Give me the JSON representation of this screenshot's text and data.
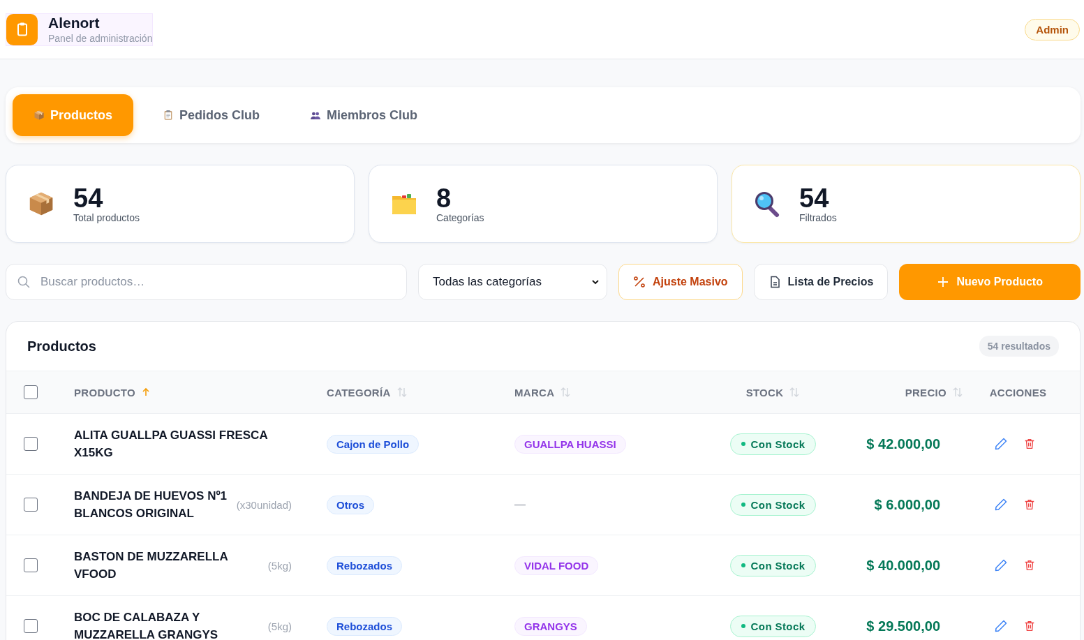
{
  "header": {
    "app_name": "Alenort",
    "subtitle": "Panel de administración",
    "role_badge": "Admin"
  },
  "tabs": [
    {
      "label": "Productos",
      "selected": true
    },
    {
      "label": "Pedidos Club",
      "selected": false
    },
    {
      "label": "Miembros Club",
      "selected": false
    }
  ],
  "stats": [
    {
      "value": "54",
      "label": "Total productos",
      "highlighted": false
    },
    {
      "value": "8",
      "label": "Categorías",
      "highlighted": false
    },
    {
      "value": "54",
      "label": "Filtrados",
      "highlighted": true
    }
  ],
  "toolbar": {
    "search": {
      "placeholder": "Buscar productos…"
    },
    "category_select": {
      "value": "Todas las categorías"
    },
    "buttons": [
      {
        "label": "Ajuste Masivo",
        "kind": "warning"
      },
      {
        "label": "Lista de Precios",
        "kind": "outline"
      },
      {
        "label": "Nuevo Producto",
        "kind": "primary"
      }
    ]
  },
  "table": {
    "title": "Productos",
    "count": "54 resultados",
    "select_all": {
      "checked": false
    },
    "columns": [
      {
        "label": "PRODUCTO",
        "kind": "sorted"
      },
      {
        "label": "CATEGORÍA",
        "kind": "sortable"
      },
      {
        "label": "MARCA",
        "kind": "sortable"
      },
      {
        "label": "STOCK",
        "kind": "sortable"
      },
      {
        "label": "PRECIO",
        "kind": "sortable"
      },
      {
        "label": "ACCIONES",
        "kind": "plain"
      }
    ],
    "rows": [
      {
        "checked": false,
        "name": "ALITA GUALLPA GUASSI FRESCA X15KG",
        "category": "Cajon de Pollo",
        "brand": "GUALLPA HUASSI",
        "stock": "Con Stock",
        "price": "$ 42.000,00"
      },
      {
        "checked": false,
        "name": "BANDEJA DE HUEVOS Nº1 BLANCOS ORIGINAL",
        "unit": "(x30unidad)",
        "category": "Otros",
        "brand_empty": "—",
        "stock": "Con Stock",
        "price": "$ 6.000,00"
      },
      {
        "checked": false,
        "name": "BASTON DE MUZZARELLA VFOOD",
        "unit": "(5kg)",
        "category": "Rebozados",
        "brand": "VIDAL FOOD",
        "stock": "Con Stock",
        "price": "$ 40.000,00"
      },
      {
        "checked": false,
        "name": "BOC DE CALABAZA Y MUZZARELLA GRANGYS",
        "unit": "(5kg)",
        "category": "Rebozados",
        "brand": "GRANGYS",
        "stock": "Con Stock",
        "price": "$ 29.500,00"
      }
    ]
  }
}
